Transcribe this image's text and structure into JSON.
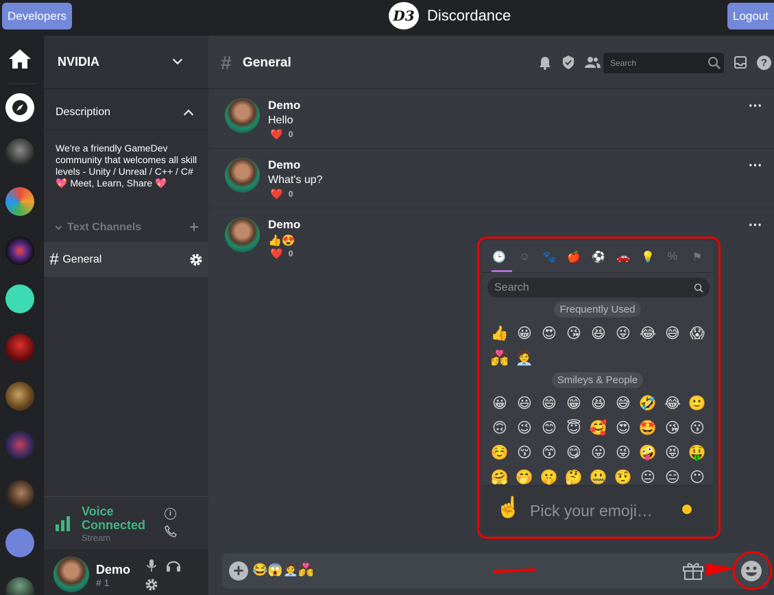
{
  "topbar": {
    "developers_label": "Developers",
    "brand_logo_text": "D3",
    "brand_name": "Discordance",
    "logout_label": "Logout"
  },
  "server": {
    "name": "NVIDIA",
    "description_title": "Description",
    "description": "We're a friendly GameDev community that welcomes all skill levels - Unity / Unreal / C++ / C# 💖 Meet, Learn, Share 💖",
    "text_channels_label": "Text Channels",
    "channel_name": "General"
  },
  "voice": {
    "status": "Voice Connected",
    "sub": "Stream"
  },
  "user": {
    "name": "Demo",
    "tag": "# 1"
  },
  "chat": {
    "channel_name": "General",
    "search_placeholder": "Search",
    "messages": [
      {
        "author": "Demo",
        "text": "Hello",
        "reaction_emoji": "❤️",
        "reaction_count": "0"
      },
      {
        "author": "Demo",
        "text": "What's up?",
        "reaction_emoji": "❤️",
        "reaction_count": "0"
      },
      {
        "author": "Demo",
        "text": "👍😍",
        "reaction_emoji": "❤️",
        "reaction_count": "0"
      }
    ],
    "composer_text": "😂😱🧑‍💼💏"
  },
  "emoji_picker": {
    "search_placeholder": "Search",
    "frequently_used_label": "Frequently Used",
    "frequently_used": [
      "👍",
      "😀",
      "😍",
      "😘",
      "😆",
      "😜",
      "😂",
      "😅",
      "😱",
      "💏",
      "🧑‍💼"
    ],
    "smileys_label": "Smileys & People",
    "smileys": [
      "😀",
      "😃",
      "😄",
      "😁",
      "😆",
      "😅",
      "🤣",
      "😂",
      "🙂",
      "🙃",
      "😉",
      "😊",
      "😇",
      "🥰",
      "😍",
      "🤩",
      "😘",
      "😗",
      "☺️",
      "😚",
      "😙",
      "😋",
      "😛",
      "😜",
      "🤪",
      "😝",
      "🤑",
      "🤗",
      "🤭",
      "🤫",
      "🤔",
      "🤐",
      "🤨",
      "😐",
      "😑",
      "😶"
    ],
    "preview_emoji": "☝️",
    "preview_text": "Pick your emoji…"
  },
  "colors": {
    "accent": "#7289da",
    "voice_green": "#43b581",
    "highlight_red": "#e00000",
    "picker_tab_active": "#b46fd6"
  }
}
